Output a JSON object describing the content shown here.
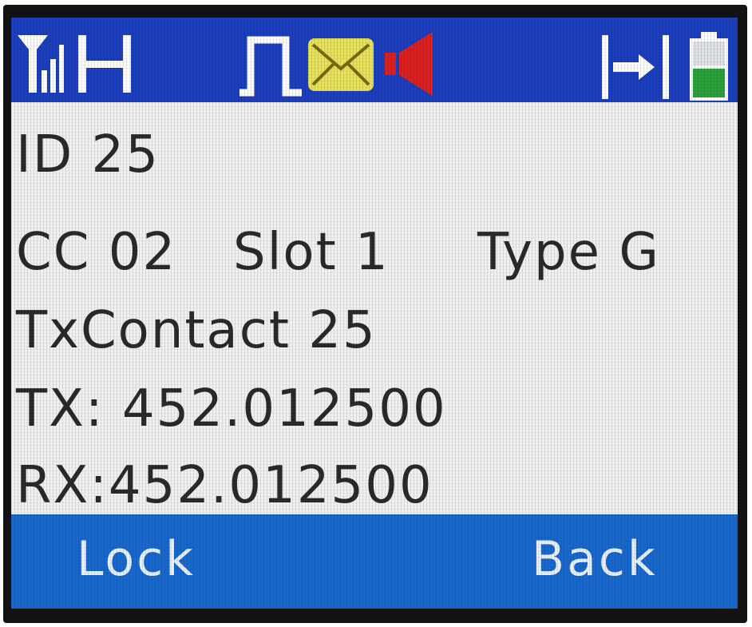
{
  "status_bar": {
    "icons": [
      "signal-strength-icon",
      "h-indicator-icon",
      "pulse-icon",
      "message-icon",
      "speaker-icon",
      "scan-icon",
      "battery-icon"
    ],
    "colors": {
      "bar": "#1b3fc0",
      "icon_white": "#ffffff",
      "message": "#e8e25a",
      "speaker": "#e02020",
      "battery_fill": "#2aa23a"
    }
  },
  "info": {
    "id": "ID 25",
    "color_code": "CC 02",
    "slot": "Slot 1",
    "type": "Type G",
    "tx_contact": "TxContact 25",
    "tx_freq": "TX: 452.012500",
    "rx_freq": "RX:452.012500"
  },
  "softkeys": {
    "left": "Lock",
    "right": "Back",
    "bar_color": "#1769cf"
  }
}
